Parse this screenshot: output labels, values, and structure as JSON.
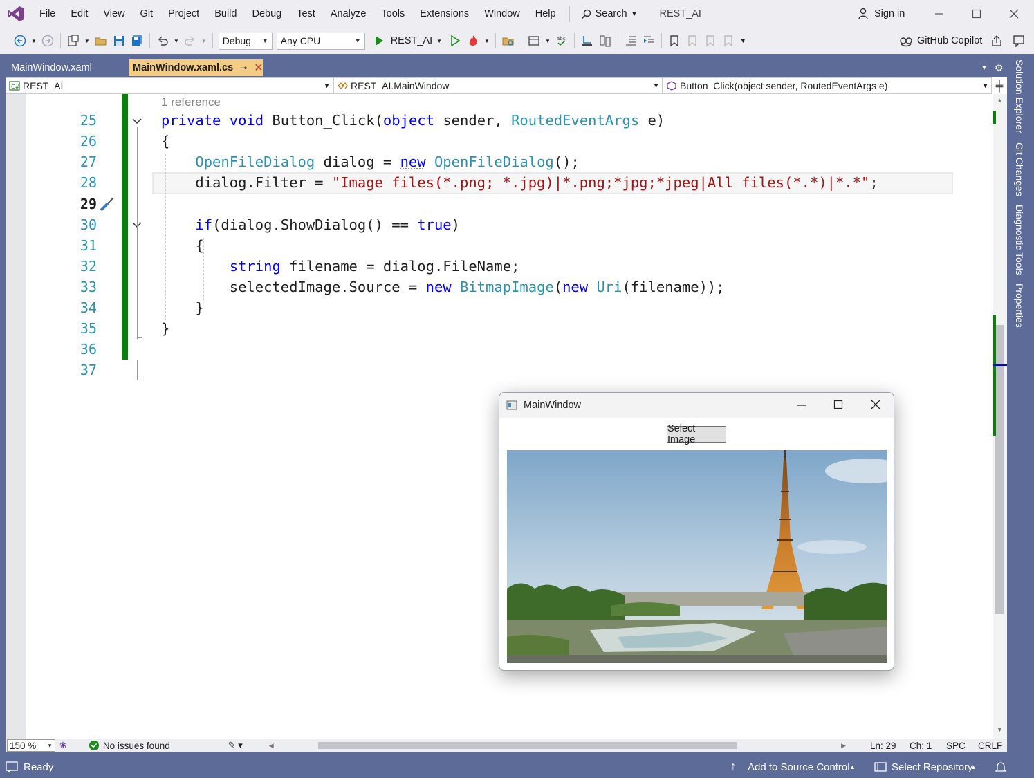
{
  "menu": {
    "items": [
      "File",
      "Edit",
      "View",
      "Git",
      "Project",
      "Build",
      "Debug",
      "Test",
      "Analyze",
      "Tools",
      "Extensions",
      "Window",
      "Help"
    ],
    "search_label": "Search",
    "solution_name": "REST_AI",
    "sign_in": "Sign in"
  },
  "toolbar": {
    "config": "Debug",
    "platform": "Any CPU",
    "run_target": "REST_AI",
    "copilot": "GitHub Copilot"
  },
  "tabs": [
    {
      "label": "MainWindow.xaml",
      "active": false
    },
    {
      "label": "MainWindow.xaml.cs",
      "active": true
    }
  ],
  "navbar": {
    "project": "REST_AI",
    "type": "REST_AI.MainWindow",
    "member": "Button_Click(object sender, RoutedEventArgs e)"
  },
  "editor": {
    "codelens": "1 reference",
    "line_numbers": [
      "25",
      "26",
      "27",
      "28",
      "29",
      "30",
      "31",
      "32",
      "33",
      "34",
      "35",
      "36",
      "37"
    ],
    "current_line": "29"
  },
  "side_tabs": [
    "Solution Explorer",
    "Git Changes",
    "Diagnostic Tools",
    "Properties"
  ],
  "edit_status": {
    "zoom": "150 %",
    "issues": "No issues found",
    "line": "Ln: 29",
    "col": "Ch: 1",
    "whitespace": "SPC",
    "eol": "CRLF"
  },
  "status": {
    "ready": "Ready",
    "source_control": "Add to Source Control",
    "repository": "Select Repository"
  },
  "app_window": {
    "title": "MainWindow",
    "button": "Select Image",
    "image": "eiffel-tower-photo"
  },
  "colors": {
    "frame": "#5d6b99",
    "active_tab": "#f5cc84",
    "keyword": "#0000ff",
    "type": "#2b91af",
    "string": "#a31515",
    "change_bar": "#107c10"
  }
}
